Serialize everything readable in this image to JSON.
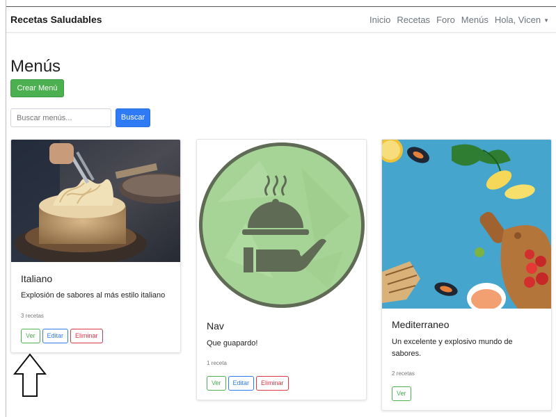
{
  "navbar": {
    "brand": "Recetas Saludables",
    "links": [
      "Inicio",
      "Recetas",
      "Foro",
      "Menús",
      "Hola, Vicen"
    ]
  },
  "page": {
    "title": "Menús",
    "create_label": "Crear Menú"
  },
  "search": {
    "placeholder": "Buscar menús...",
    "button_label": "Buscar"
  },
  "cards": [
    {
      "title": "Italiano",
      "description": "Explosión de sabores al más estilo italiano",
      "count": "3 recetas",
      "buttons": [
        "Ver",
        "Editar",
        "Eliminar"
      ]
    },
    {
      "title": "Nav",
      "description": "Que guapardo!",
      "count": "1 receta",
      "buttons": [
        "Ver",
        "Editar",
        "Eliminar"
      ]
    },
    {
      "title": "Mediterraneo",
      "description": "Un excelente y explosivo mundo de sabores.",
      "count": "2 recetas",
      "buttons": [
        "Ver"
      ]
    }
  ],
  "colors": {
    "success": "#4caf50",
    "primary": "#2f7bf5",
    "danger": "#dc3545",
    "placeholder_bg": "#a6d496",
    "placeholder_ring": "#5f6b55"
  },
  "icons": {
    "nav_placeholder": "serving-cloche-hand-icon",
    "dropdown": "caret-down-icon",
    "pointer": "up-arrow-icon"
  }
}
